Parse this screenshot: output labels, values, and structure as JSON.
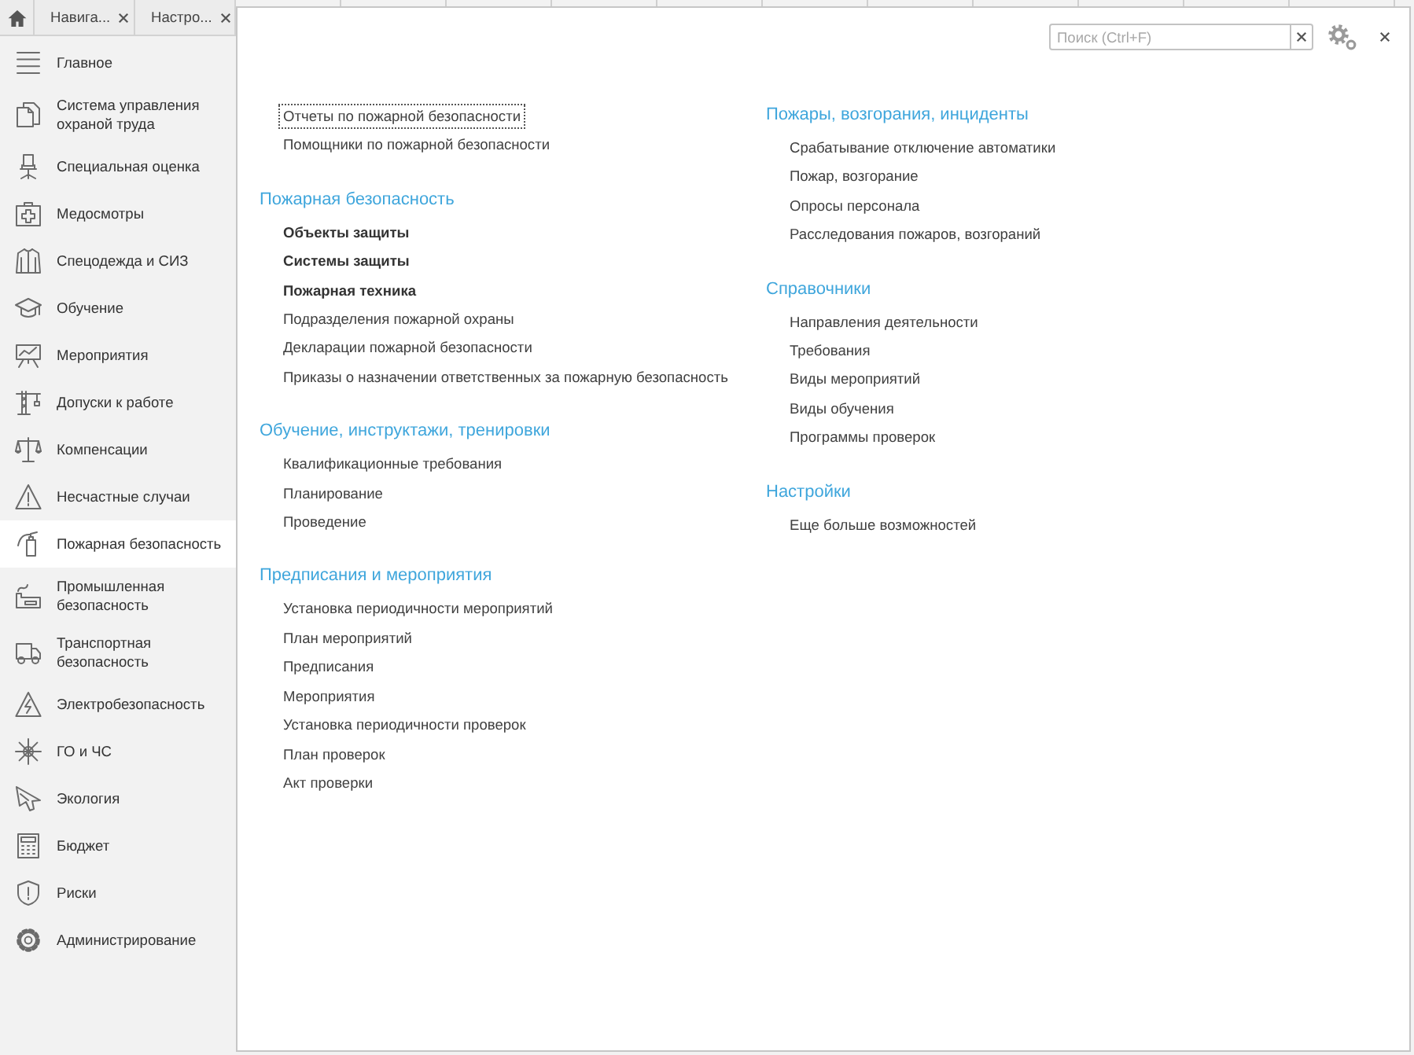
{
  "tabs": [
    {
      "kind": "home",
      "selected": false
    },
    {
      "kind": "page",
      "label": "Навига...",
      "selected": false
    },
    {
      "kind": "page",
      "label": "Настро...",
      "selected": false
    }
  ],
  "sections": [
    {
      "label": "Главное",
      "selected": false
    },
    {
      "label": "Система управления охраной труда",
      "selected": false
    },
    {
      "label": "Специальная оценка",
      "selected": false
    },
    {
      "label": "Медосмотры",
      "selected": false
    },
    {
      "label": "Спецодежда и СИЗ",
      "selected": false
    },
    {
      "label": "Обучение",
      "selected": false
    },
    {
      "label": "Мероприятия",
      "selected": false
    },
    {
      "label": "Допуски к работе",
      "selected": false
    },
    {
      "label": "Компенсации",
      "selected": false
    },
    {
      "label": "Несчастные случаи",
      "selected": false
    },
    {
      "label": "Пожарная безопасность",
      "selected": true
    },
    {
      "label": "Промышленная безопасность",
      "selected": false
    },
    {
      "label": "Транспортная безопасность",
      "selected": false
    },
    {
      "label": "Электробезопасность",
      "selected": false
    },
    {
      "label": "ГО и ЧС",
      "selected": false
    },
    {
      "label": "Экология",
      "selected": false
    },
    {
      "label": "Бюджет",
      "selected": false
    },
    {
      "label": "Риски",
      "selected": false
    },
    {
      "label": "Администрирование",
      "selected": false
    }
  ],
  "search": {
    "placeholder": "Поиск (Ctrl+F)"
  },
  "columns": [
    {
      "groups": [
        {
          "items": [
            {
              "label": "Отчеты по пожарной безопасности",
              "important": false,
              "focused": true
            },
            {
              "label": "Помощники по пожарной безопасности",
              "important": false,
              "focused": false
            }
          ]
        },
        {
          "title": "Пожарная безопасность",
          "items": [
            {
              "label": "Объекты защиты",
              "important": true,
              "focused": false
            },
            {
              "label": "Системы защиты",
              "important": true,
              "focused": false
            },
            {
              "label": "Пожарная техника",
              "important": true,
              "focused": false
            },
            {
              "label": "Подразделения пожарной охраны",
              "important": false,
              "focused": false
            },
            {
              "label": "Декларации пожарной безопасности",
              "important": false,
              "focused": false
            },
            {
              "label": "Приказы о назначении ответственных за пожарную безопасность",
              "important": false,
              "focused": false
            }
          ]
        },
        {
          "title": "Обучение, инструктажи, тренировки",
          "items": [
            {
              "label": "Квалификационные требования",
              "important": false,
              "focused": false
            },
            {
              "label": "Планирование",
              "important": false,
              "focused": false
            },
            {
              "label": "Проведение",
              "important": false,
              "focused": false
            }
          ]
        },
        {
          "title": "Предписания и мероприятия",
          "items": [
            {
              "label": "Установка периодичности мероприятий",
              "important": false,
              "focused": false
            },
            {
              "label": "План мероприятий",
              "important": false,
              "focused": false
            },
            {
              "label": "Предписания",
              "important": false,
              "focused": false
            },
            {
              "label": "Мероприятия",
              "important": false,
              "focused": false
            },
            {
              "label": "Установка периодичности проверок",
              "important": false,
              "focused": false
            },
            {
              "label": "План проверок",
              "important": false,
              "focused": false
            },
            {
              "label": "Акт проверки",
              "important": false,
              "focused": false
            }
          ]
        }
      ]
    },
    {
      "groups": [
        {
          "title": "Пожары, возгорания, инциденты",
          "items": [
            {
              "label": "Срабатывание отключение автоматики",
              "important": false,
              "focused": false
            },
            {
              "label": "Пожар, возгорание",
              "important": false,
              "focused": false
            },
            {
              "label": "Опросы персонала",
              "important": false,
              "focused": false
            },
            {
              "label": "Расследования пожаров, возгораний",
              "important": false,
              "focused": false
            }
          ]
        },
        {
          "title": "Справочники",
          "items": [
            {
              "label": "Направления деятельности",
              "important": false,
              "focused": false
            },
            {
              "label": "Требования",
              "important": false,
              "focused": false
            },
            {
              "label": "Виды мероприятий",
              "important": false,
              "focused": false
            },
            {
              "label": "Виды обучения",
              "important": false,
              "focused": false
            },
            {
              "label": "Программы проверок",
              "important": false,
              "focused": false
            }
          ]
        },
        {
          "title": "Настройки",
          "items": [
            {
              "label": "Еще больше возможностей",
              "important": false,
              "focused": false
            }
          ]
        }
      ]
    }
  ]
}
